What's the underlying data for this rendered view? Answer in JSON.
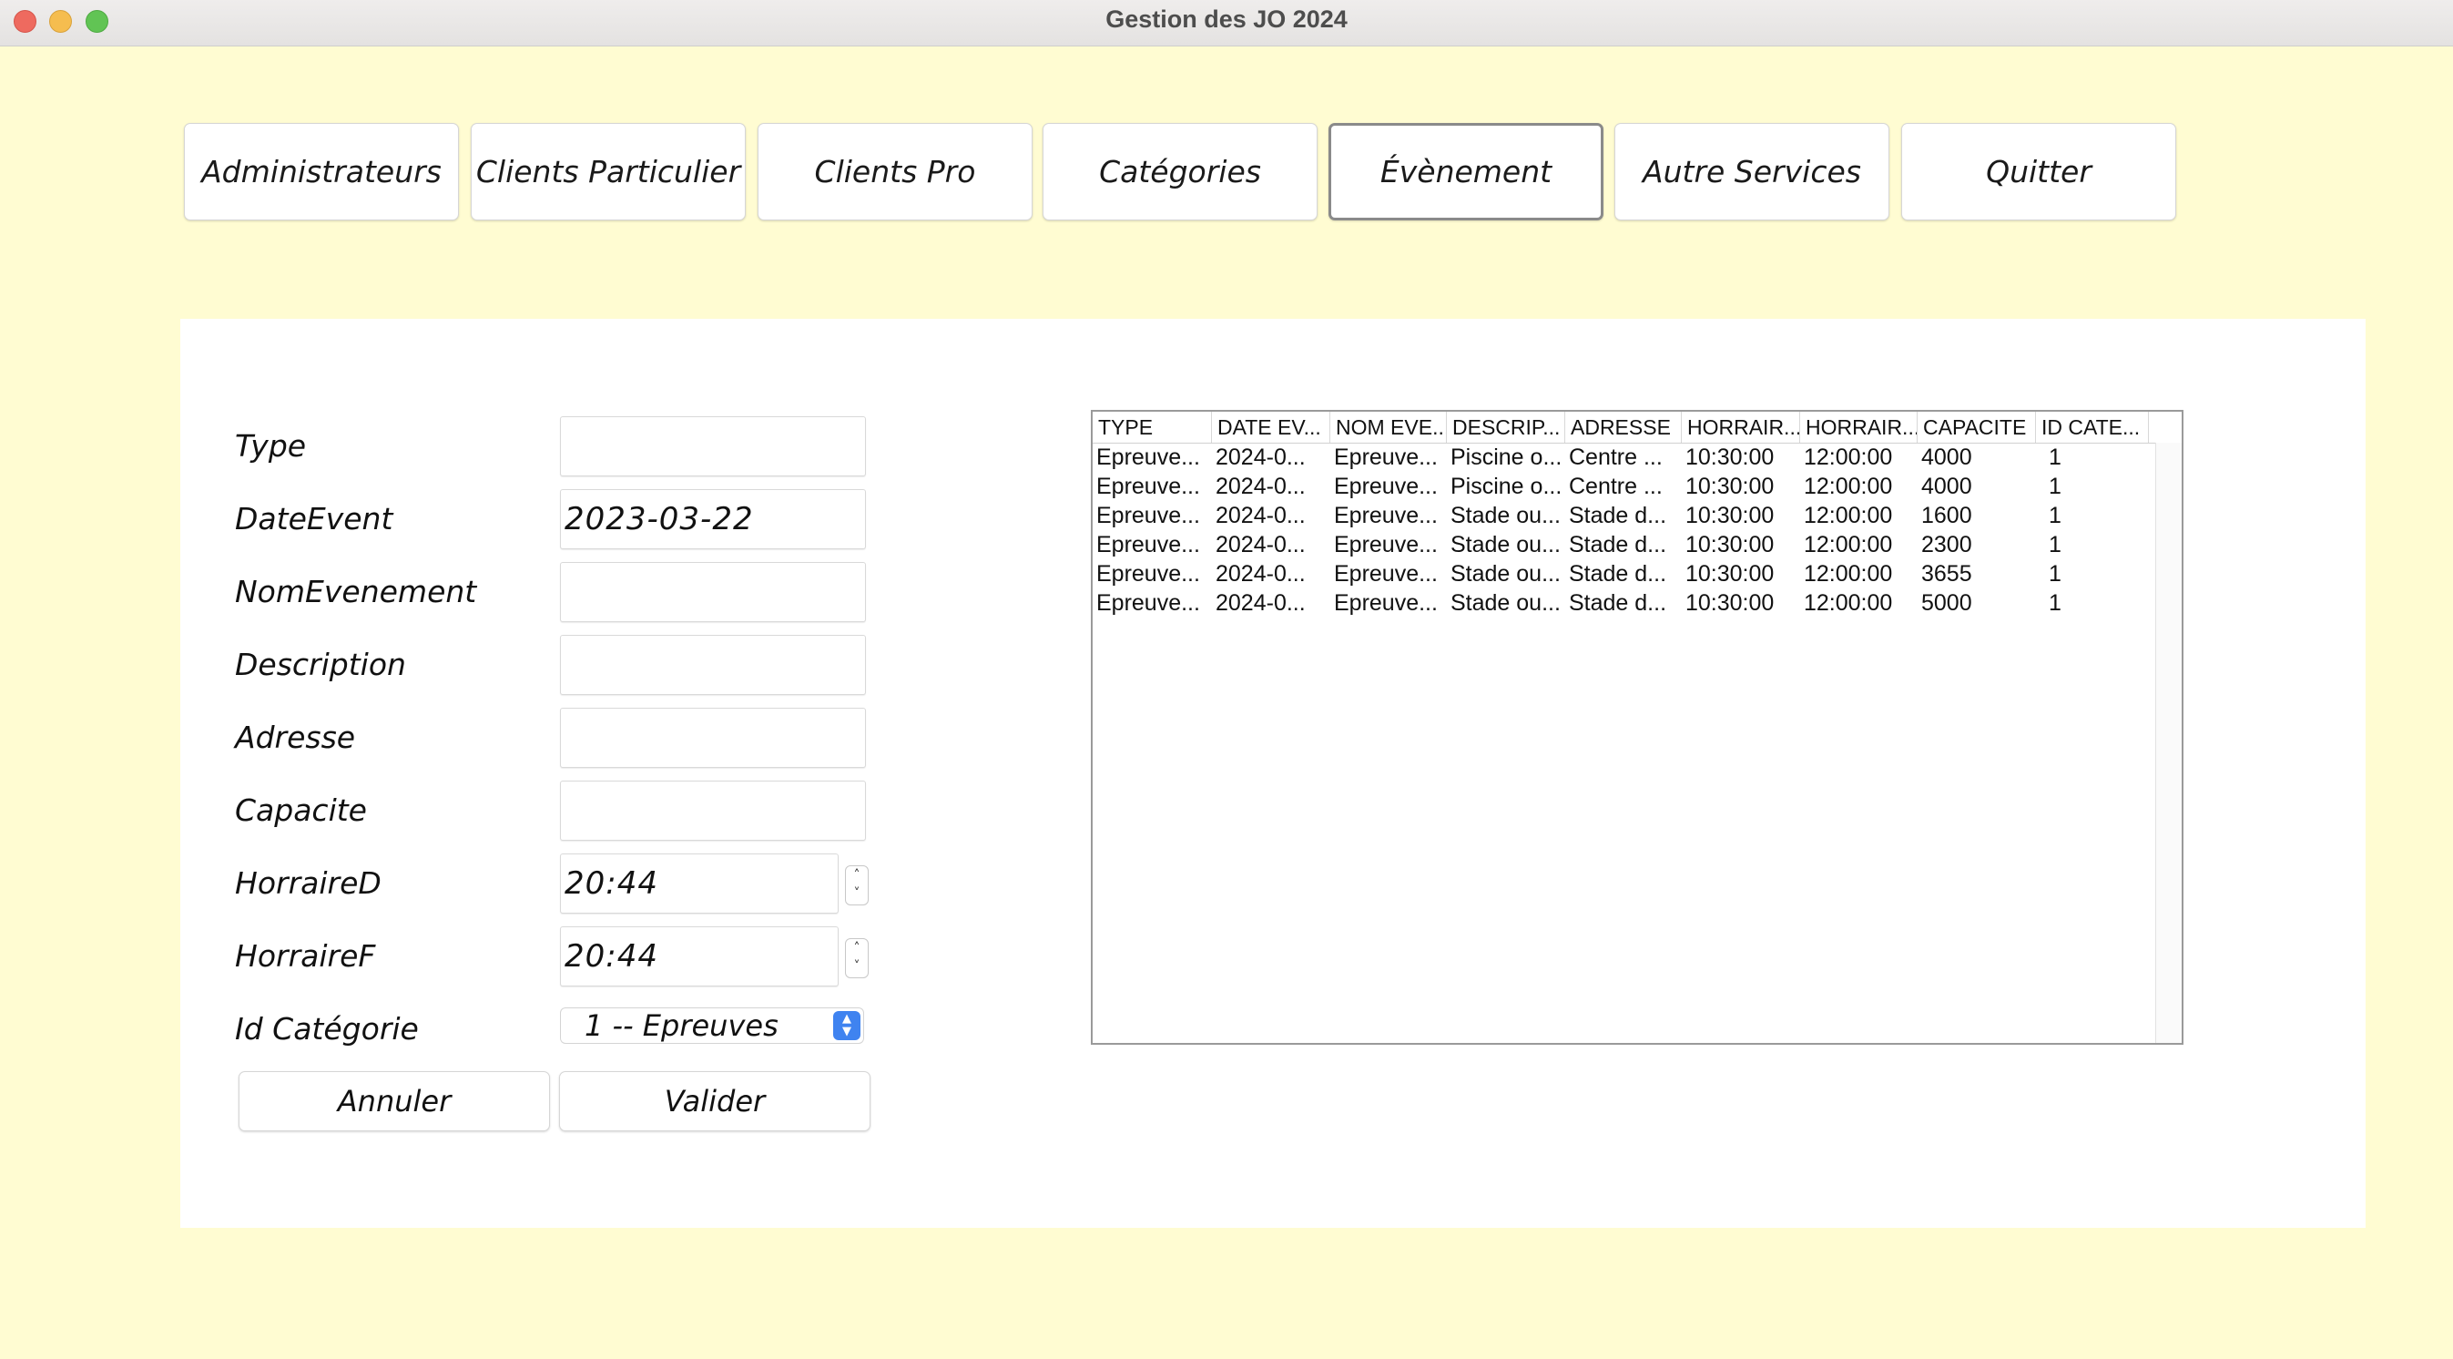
{
  "window": {
    "title": "Gestion des JO 2024"
  },
  "nav": [
    {
      "label": "Administrateurs",
      "active": false
    },
    {
      "label": "Clients Particulier",
      "active": false
    },
    {
      "label": "Clients Pro",
      "active": false
    },
    {
      "label": "Catégories",
      "active": false
    },
    {
      "label": "Évènement",
      "active": true
    },
    {
      "label": "Autre Services",
      "active": false
    },
    {
      "label": "Quitter",
      "active": false
    }
  ],
  "form": {
    "labels": {
      "type": "Type",
      "date": "DateEvent",
      "nom": "NomEvenement",
      "description": "Description",
      "adresse": "Adresse",
      "capacite": "Capacite",
      "horraire_d": "HorraireD",
      "horraire_f": "HorraireF",
      "id_categorie": "Id Catégorie"
    },
    "values": {
      "type": "",
      "date": "2023-03-22",
      "nom": "",
      "description": "",
      "adresse": "",
      "capacite": "",
      "horraire_d": "20:44",
      "horraire_f": "20:44",
      "id_categorie": "1 -- Epreuves"
    },
    "buttons": {
      "cancel": "Annuler",
      "submit": "Valider"
    }
  },
  "table": {
    "columns": [
      "TYPE",
      "DATE EV...",
      "NOM EVE...",
      "DESCRIP...",
      "ADRESSE",
      "HORRAIR...",
      "HORRAIR...",
      "CAPACITE",
      "ID CATE..."
    ],
    "rows": [
      [
        "Epreuve...",
        "2024-0...",
        "Epreuve...",
        "Piscine o...",
        "Centre ...",
        "10:30:00",
        "12:00:00",
        "4000",
        "1"
      ],
      [
        "Epreuve...",
        "2024-0...",
        "Epreuve...",
        "Piscine o...",
        "Centre ...",
        "10:30:00",
        "12:00:00",
        "4000",
        "1"
      ],
      [
        "Epreuve...",
        "2024-0...",
        "Epreuve...",
        "Stade ou...",
        "Stade d...",
        "10:30:00",
        "12:00:00",
        "1600",
        "1"
      ],
      [
        "Epreuve...",
        "2024-0...",
        "Epreuve...",
        "Stade ou...",
        "Stade d...",
        "10:30:00",
        "12:00:00",
        "2300",
        "1"
      ],
      [
        "Epreuve...",
        "2024-0...",
        "Epreuve...",
        "Stade ou...",
        "Stade d...",
        "10:30:00",
        "12:00:00",
        "3655",
        "1"
      ],
      [
        "Epreuve...",
        "2024-0...",
        "Epreuve...",
        "Stade ou...",
        "Stade d...",
        "10:30:00",
        "12:00:00",
        "5000",
        "1"
      ]
    ]
  }
}
